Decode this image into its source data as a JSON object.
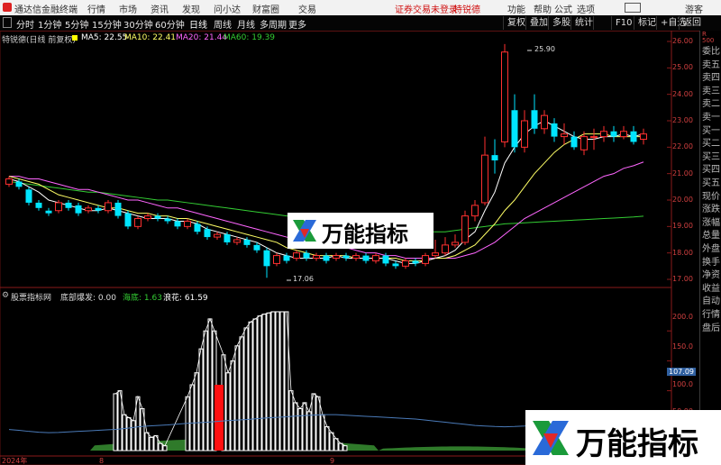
{
  "titlebar": {
    "app_title": "通达信金融终端",
    "menu": [
      "行情",
      "市场",
      "资讯",
      "发现",
      "问小达",
      "财富圈",
      "交易"
    ],
    "status_login": "证券交易未登录",
    "status_stock": "特锐德",
    "right_items": [
      "功能",
      "帮助",
      "公式",
      "选项",
      "游客"
    ]
  },
  "toolbar": {
    "periods": [
      "分时",
      "1分钟",
      "5分钟",
      "15分钟",
      "30分钟",
      "60分钟",
      "日线",
      "周线",
      "月线",
      "多周期",
      "更多"
    ],
    "active_period": "日线",
    "right_buttons": [
      "复权",
      "叠加",
      "多股",
      "统计",
      "F10",
      "标记",
      "+自选",
      "返回"
    ]
  },
  "chart_info": {
    "stock_label": "特锐德(日线 前复权)",
    "ma5_label": "MA5: 22.55",
    "ma10_label": "MA10: 22.41",
    "ma20_label": "MA20: 21.44",
    "ma60_label": "MA60: 19.39",
    "colors": {
      "ma5": "#ffffff",
      "ma10": "#ffff66",
      "ma20": "#ff66ff",
      "ma60": "#33cc33"
    }
  },
  "annotations": {
    "high_label": "25.90",
    "low_label": "17.06"
  },
  "price_axis": [
    "26.00",
    "25.00",
    "24.00",
    "23.00",
    "22.00",
    "21.00",
    "20.00",
    "19.00",
    "18.00",
    "17.00"
  ],
  "indicator_info": {
    "name_label": "股票指标网",
    "bottom_label": "底部爆发: 0.00",
    "sea_label": "海底: 1.63",
    "flower_label": "浪花: 61.59"
  },
  "indicator_axis": [
    "200.0",
    "150.0",
    "100.0",
    "50.00"
  ],
  "indicator_current": "107.09",
  "date_axis": [
    "2024年",
    "8",
    "9"
  ],
  "side_panel": [
    "R",
    "500",
    "委比",
    "卖五",
    "卖四",
    "卖三",
    "卖二",
    "卖一",
    "买一",
    "买二",
    "买三",
    "买四",
    "买五",
    "现价",
    "涨跌",
    "涨幅",
    "总量",
    "外盘",
    "换手",
    "净资",
    "收益",
    "自动",
    "行情",
    "盘后"
  ],
  "watermark": "万能指标",
  "chart_data": {
    "type": "candlestick",
    "ylim": [
      17.0,
      26.0
    ],
    "candles": [
      {
        "o": 20.6,
        "c": 20.8,
        "h": 20.9,
        "l": 20.5
      },
      {
        "o": 20.7,
        "c": 20.5,
        "h": 20.8,
        "l": 20.4
      },
      {
        "o": 20.4,
        "c": 19.9,
        "h": 20.5,
        "l": 19.8
      },
      {
        "o": 19.9,
        "c": 19.7,
        "h": 20.0,
        "l": 19.6
      },
      {
        "o": 19.6,
        "c": 19.5,
        "h": 19.7,
        "l": 19.4
      },
      {
        "o": 19.6,
        "c": 19.9,
        "h": 20.0,
        "l": 19.5
      },
      {
        "o": 19.9,
        "c": 19.7,
        "h": 20.0,
        "l": 19.6
      },
      {
        "o": 19.8,
        "c": 19.5,
        "h": 19.9,
        "l": 19.4
      },
      {
        "o": 19.6,
        "c": 19.7,
        "h": 19.8,
        "l": 19.5
      },
      {
        "o": 19.7,
        "c": 19.6,
        "h": 19.8,
        "l": 19.5
      },
      {
        "o": 19.6,
        "c": 19.9,
        "h": 20.0,
        "l": 19.5
      },
      {
        "o": 19.9,
        "c": 19.4,
        "h": 20.0,
        "l": 19.3
      },
      {
        "o": 19.5,
        "c": 19.0,
        "h": 19.6,
        "l": 18.9
      },
      {
        "o": 19.0,
        "c": 19.3,
        "h": 19.4,
        "l": 18.9
      },
      {
        "o": 19.3,
        "c": 19.4,
        "h": 19.5,
        "l": 19.2
      },
      {
        "o": 19.4,
        "c": 19.3,
        "h": 19.5,
        "l": 19.2
      },
      {
        "o": 19.3,
        "c": 19.2,
        "h": 19.4,
        "l": 19.1
      },
      {
        "o": 19.2,
        "c": 19.0,
        "h": 19.3,
        "l": 18.9
      },
      {
        "o": 19.0,
        "c": 19.2,
        "h": 19.3,
        "l": 18.9
      },
      {
        "o": 19.1,
        "c": 18.8,
        "h": 19.2,
        "l": 18.7
      },
      {
        "o": 18.9,
        "c": 18.6,
        "h": 19.0,
        "l": 18.5
      },
      {
        "o": 18.6,
        "c": 18.7,
        "h": 18.8,
        "l": 18.5
      },
      {
        "o": 18.7,
        "c": 18.4,
        "h": 18.8,
        "l": 18.3
      },
      {
        "o": 18.4,
        "c": 18.5,
        "h": 18.6,
        "l": 18.3
      },
      {
        "o": 18.5,
        "c": 18.3,
        "h": 18.6,
        "l": 18.2
      },
      {
        "o": 18.3,
        "c": 18.1,
        "h": 18.4,
        "l": 18.0
      },
      {
        "o": 18.1,
        "c": 17.5,
        "h": 18.2,
        "l": 17.06
      },
      {
        "o": 17.6,
        "c": 17.9,
        "h": 18.0,
        "l": 17.5
      },
      {
        "o": 17.9,
        "c": 17.7,
        "h": 18.0,
        "l": 17.6
      },
      {
        "o": 17.8,
        "c": 18.0,
        "h": 18.1,
        "l": 17.7
      },
      {
        "o": 18.0,
        "c": 17.8,
        "h": 18.1,
        "l": 17.7
      },
      {
        "o": 17.8,
        "c": 17.9,
        "h": 18.0,
        "l": 17.7
      },
      {
        "o": 17.9,
        "c": 17.7,
        "h": 18.0,
        "l": 17.6
      },
      {
        "o": 17.8,
        "c": 17.9,
        "h": 18.0,
        "l": 17.7
      },
      {
        "o": 17.9,
        "c": 17.8,
        "h": 18.0,
        "l": 17.7
      },
      {
        "o": 17.8,
        "c": 17.9,
        "h": 18.0,
        "l": 17.7
      },
      {
        "o": 17.9,
        "c": 17.7,
        "h": 18.0,
        "l": 17.6
      },
      {
        "o": 17.7,
        "c": 17.9,
        "h": 18.0,
        "l": 17.6
      },
      {
        "o": 17.9,
        "c": 17.6,
        "h": 18.0,
        "l": 17.5
      },
      {
        "o": 17.6,
        "c": 17.5,
        "h": 17.7,
        "l": 17.4
      },
      {
        "o": 17.5,
        "c": 17.7,
        "h": 17.8,
        "l": 17.4
      },
      {
        "o": 17.7,
        "c": 17.6,
        "h": 17.8,
        "l": 17.5
      },
      {
        "o": 17.6,
        "c": 17.9,
        "h": 18.0,
        "l": 17.5
      },
      {
        "o": 17.9,
        "c": 18.0,
        "h": 18.5,
        "l": 17.8
      },
      {
        "o": 18.0,
        "c": 18.3,
        "h": 18.6,
        "l": 17.9
      },
      {
        "o": 18.3,
        "c": 18.4,
        "h": 18.7,
        "l": 18.2
      },
      {
        "o": 18.4,
        "c": 19.4,
        "h": 19.6,
        "l": 18.3
      },
      {
        "o": 19.4,
        "c": 19.8,
        "h": 20.0,
        "l": 19.2
      },
      {
        "o": 19.9,
        "c": 21.7,
        "h": 22.4,
        "l": 19.8
      },
      {
        "o": 21.7,
        "c": 21.5,
        "h": 22.3,
        "l": 21.0
      },
      {
        "o": 22.2,
        "c": 25.6,
        "h": 25.9,
        "l": 22.0
      },
      {
        "o": 23.4,
        "c": 22.0,
        "h": 24.0,
        "l": 21.8
      },
      {
        "o": 22.0,
        "c": 23.0,
        "h": 23.4,
        "l": 21.8
      },
      {
        "o": 23.4,
        "c": 22.7,
        "h": 24.0,
        "l": 22.5
      },
      {
        "o": 22.7,
        "c": 23.2,
        "h": 23.4,
        "l": 22.5
      },
      {
        "o": 22.9,
        "c": 22.4,
        "h": 23.1,
        "l": 22.2
      },
      {
        "o": 22.4,
        "c": 22.5,
        "h": 22.9,
        "l": 22.1
      },
      {
        "o": 22.4,
        "c": 22.0,
        "h": 22.6,
        "l": 21.9
      },
      {
        "o": 21.9,
        "c": 22.4,
        "h": 22.6,
        "l": 21.7
      },
      {
        "o": 22.4,
        "c": 22.4,
        "h": 22.7,
        "l": 21.9
      },
      {
        "o": 22.4,
        "c": 22.6,
        "h": 22.8,
        "l": 22.2
      },
      {
        "o": 22.6,
        "c": 22.4,
        "h": 22.8,
        "l": 22.2
      },
      {
        "o": 22.4,
        "c": 22.6,
        "h": 22.8,
        "l": 22.3
      },
      {
        "o": 22.6,
        "c": 22.2,
        "h": 22.8,
        "l": 22.1
      },
      {
        "o": 22.3,
        "c": 22.5,
        "h": 22.7,
        "l": 22.1
      }
    ],
    "ma5": [
      20.8,
      20.7,
      20.5,
      20.3,
      20.0,
      19.9,
      19.8,
      19.7,
      19.6,
      19.6,
      19.7,
      19.6,
      19.5,
      19.4,
      19.3,
      19.3,
      19.3,
      19.2,
      19.2,
      19.1,
      18.9,
      18.8,
      18.7,
      18.6,
      18.5,
      18.4,
      18.2,
      18.0,
      17.9,
      17.8,
      17.8,
      17.8,
      17.8,
      17.9,
      17.8,
      17.8,
      17.8,
      17.8,
      17.8,
      17.7,
      17.6,
      17.6,
      17.7,
      17.8,
      17.9,
      18.1,
      18.5,
      18.8,
      19.6,
      20.3,
      21.4,
      22.0,
      22.5,
      22.8,
      23.0,
      22.8,
      22.6,
      22.4,
      22.3,
      22.3,
      22.4,
      22.4,
      22.5,
      22.4,
      22.5
    ],
    "ma10": [
      20.9,
      20.8,
      20.7,
      20.6,
      20.4,
      20.2,
      20.1,
      20.0,
      19.9,
      19.8,
      19.7,
      19.7,
      19.6,
      19.5,
      19.5,
      19.4,
      19.4,
      19.3,
      19.3,
      19.2,
      19.1,
      19.0,
      18.9,
      18.8,
      18.7,
      18.6,
      18.5,
      18.4,
      18.2,
      18.1,
      18.0,
      17.9,
      17.9,
      17.9,
      17.9,
      17.8,
      17.8,
      17.8,
      17.8,
      17.8,
      17.7,
      17.7,
      17.7,
      17.8,
      17.8,
      17.9,
      18.1,
      18.3,
      18.7,
      19.1,
      19.6,
      20.0,
      20.5,
      21.0,
      21.4,
      21.8,
      22.1,
      22.3,
      22.5,
      22.5,
      22.5,
      22.4,
      22.4,
      22.4,
      22.4
    ],
    "ma20": [
      20.9,
      20.9,
      20.8,
      20.8,
      20.7,
      20.6,
      20.5,
      20.4,
      20.4,
      20.3,
      20.2,
      20.1,
      20.0,
      20.0,
      19.9,
      19.8,
      19.7,
      19.7,
      19.6,
      19.5,
      19.4,
      19.3,
      19.2,
      19.1,
      19.0,
      18.9,
      18.8,
      18.7,
      18.6,
      18.5,
      18.4,
      18.3,
      18.3,
      18.2,
      18.2,
      18.1,
      18.0,
      18.0,
      17.9,
      17.9,
      17.8,
      17.8,
      17.8,
      17.8,
      17.8,
      17.8,
      17.9,
      18.0,
      18.2,
      18.4,
      18.7,
      19.0,
      19.3,
      19.5,
      19.7,
      19.9,
      20.1,
      20.3,
      20.5,
      20.7,
      20.9,
      21.0,
      21.2,
      21.3,
      21.44
    ],
    "ma60": [
      20.7,
      20.65,
      20.6,
      20.55,
      20.5,
      20.45,
      20.4,
      20.35,
      20.3,
      20.3,
      20.25,
      20.2,
      20.15,
      20.1,
      20.05,
      20.0,
      20.0,
      19.95,
      19.9,
      19.85,
      19.8,
      19.75,
      19.7,
      19.65,
      19.6,
      19.55,
      19.5,
      19.45,
      19.4,
      19.35,
      19.3,
      19.25,
      19.2,
      19.15,
      19.1,
      19.05,
      19.0,
      18.95,
      18.9,
      18.85,
      18.8,
      18.8,
      18.8,
      18.8,
      18.8,
      18.85,
      18.9,
      18.95,
      19.0,
      19.05,
      19.1,
      19.12,
      19.14,
      19.16,
      19.18,
      19.2,
      19.22,
      19.24,
      19.26,
      19.28,
      19.3,
      19.32,
      19.34,
      19.36,
      19.39
    ],
    "indicator": {
      "ylim": [
        0,
        250
      ],
      "bars": [
        0,
        0,
        0,
        0,
        0,
        0,
        0,
        0,
        0,
        0,
        0,
        0,
        0,
        0,
        0,
        0,
        0,
        0,
        0,
        0,
        0,
        0,
        0,
        0,
        0,
        0,
        0,
        0,
        0,
        0,
        0,
        0,
        0,
        0,
        0,
        0,
        0,
        0,
        0,
        0,
        0,
        0,
        0,
        0,
        0,
        0,
        0,
        0,
        0,
        0,
        0,
        0,
        0,
        0,
        0,
        0,
        0,
        0,
        0,
        0,
        0,
        0,
        0,
        0,
        0
      ],
      "line": [
        45,
        42,
        38,
        35,
        33,
        34,
        36,
        38,
        40,
        42,
        44,
        46,
        50,
        55,
        58,
        60,
        62,
        65,
        68,
        70,
        72,
        75,
        78,
        80,
        82,
        85,
        88,
        90,
        92,
        95,
        97,
        99,
        100,
        100,
        98,
        96,
        94,
        92,
        90,
        88,
        86,
        84,
        80,
        76,
        72,
        68,
        64,
        60,
        58,
        56,
        55,
        56,
        58,
        62,
        66,
        70,
        74,
        78,
        82,
        86,
        90,
        95,
        100,
        105,
        107.09
      ]
    },
    "sea_area": [
      0,
      0,
      0,
      0,
      0,
      0,
      0,
      0,
      0,
      0,
      0,
      0,
      0,
      0,
      0,
      0,
      0,
      0,
      0,
      0,
      0,
      0,
      0,
      0,
      0,
      0,
      0,
      0,
      0,
      0,
      0,
      0,
      0,
      0,
      0,
      0,
      0,
      0,
      0,
      0,
      0,
      0,
      0,
      0,
      0,
      0,
      0,
      0,
      0,
      0,
      0,
      0,
      0,
      0,
      0,
      0,
      0,
      0,
      0,
      0,
      0,
      0,
      0,
      0,
      0
    ],
    "flower_bars": [
      {
        "x": 128,
        "v": 95
      },
      {
        "x": 133,
        "v": 100
      },
      {
        "x": 138,
        "v": 60
      },
      {
        "x": 143,
        "v": 55
      },
      {
        "x": 148,
        "v": 50
      },
      {
        "x": 153,
        "v": 90
      },
      {
        "x": 158,
        "v": 70
      },
      {
        "x": 163,
        "v": 30
      },
      {
        "x": 168,
        "v": 22
      },
      {
        "x": 173,
        "v": 25
      },
      {
        "x": 178,
        "v": 12
      },
      {
        "x": 183,
        "v": 8
      },
      {
        "x": 208,
        "v": 90
      },
      {
        "x": 213,
        "v": 110
      },
      {
        "x": 218,
        "v": 130
      },
      {
        "x": 223,
        "v": 170
      },
      {
        "x": 228,
        "v": 200
      },
      {
        "x": 233,
        "v": 220
      },
      {
        "x": 238,
        "v": 200
      },
      {
        "x": 248,
        "v": 160
      },
      {
        "x": 253,
        "v": 130
      },
      {
        "x": 258,
        "v": 150
      },
      {
        "x": 263,
        "v": 175
      },
      {
        "x": 268,
        "v": 190
      },
      {
        "x": 273,
        "v": 205
      },
      {
        "x": 278,
        "v": 215
      },
      {
        "x": 283,
        "v": 220
      },
      {
        "x": 288,
        "v": 225
      },
      {
        "x": 293,
        "v": 228
      },
      {
        "x": 298,
        "v": 230
      },
      {
        "x": 303,
        "v": 232
      },
      {
        "x": 308,
        "v": 232
      },
      {
        "x": 313,
        "v": 232
      },
      {
        "x": 318,
        "v": 232
      },
      {
        "x": 323,
        "v": 100
      },
      {
        "x": 328,
        "v": 80
      },
      {
        "x": 333,
        "v": 70
      },
      {
        "x": 338,
        "v": 80
      },
      {
        "x": 343,
        "v": 65
      },
      {
        "x": 348,
        "v": 95
      },
      {
        "x": 353,
        "v": 90
      },
      {
        "x": 358,
        "v": 60
      },
      {
        "x": 363,
        "v": 40
      },
      {
        "x": 368,
        "v": 30
      },
      {
        "x": 373,
        "v": 20
      },
      {
        "x": 378,
        "v": 12
      },
      {
        "x": 383,
        "v": 8
      }
    ],
    "red_bar": {
      "x": 243,
      "v": 110
    }
  }
}
